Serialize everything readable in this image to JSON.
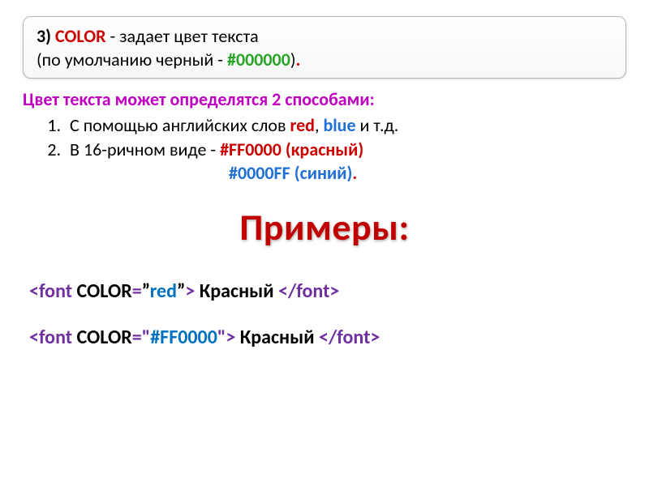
{
  "box": {
    "prefix": "3) ",
    "keyword": "COLOR",
    "desc": " - задает цвет текста",
    "sub_open": " (",
    "sub_text": "по умолчанию черный - ",
    "sub_code": "#000000",
    "sub_close": ")",
    "sub_dot": "."
  },
  "intro": "Цвет текста может определятся 2 способами:",
  "list": {
    "item1": {
      "a": "С помощью английских слов ",
      "red": "red",
      "comma": ", ",
      "blue": "blue",
      "tail": " и т.д."
    },
    "item2": {
      "a": "В 16-ричном виде - ",
      "code": "#FF0000 (красный)"
    }
  },
  "line3": {
    "code": "#0000FF (синий)",
    "dot": "."
  },
  "title": "Примеры:",
  "ex1": {
    "open": "<font",
    "sp": " ",
    "attr": "COLOR",
    "eq": "=",
    "q1": "”",
    "val": "red",
    "q2": "”",
    "gt": ">",
    "text": " Красный ",
    "close": "</font>"
  },
  "ex2": {
    "open": "<font",
    "sp": " ",
    "attr": "COLOR",
    "eq": "=\"",
    "val": "#FF0000",
    "eq2": "\">",
    "text": " Красный ",
    "close": "</font>"
  }
}
